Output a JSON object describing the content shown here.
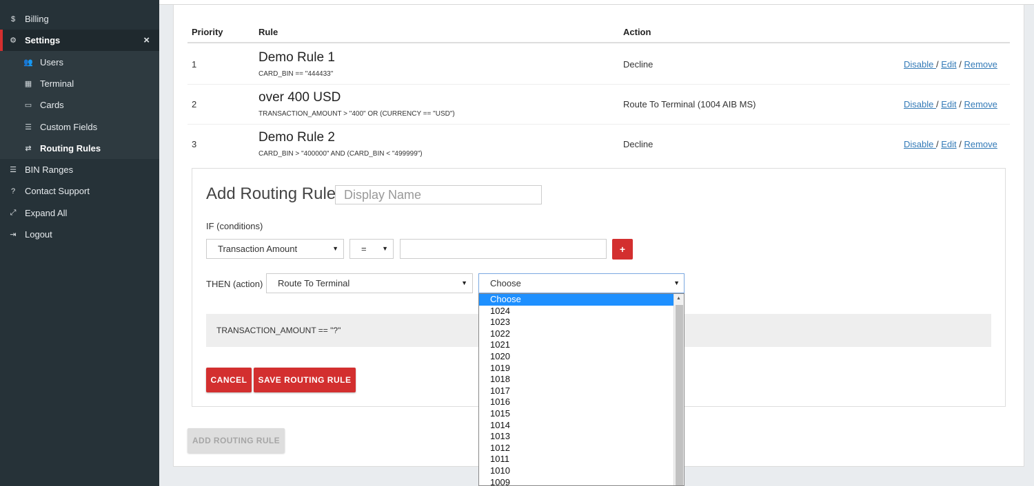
{
  "sidebar": {
    "items": [
      {
        "label": "Billing",
        "icon": "dollar-icon"
      },
      {
        "label": "Settings",
        "icon": "cogs-icon"
      },
      {
        "label": "BIN Ranges",
        "icon": "list-icon"
      },
      {
        "label": "Contact Support",
        "icon": "question-circle-icon"
      },
      {
        "label": "Expand All",
        "icon": "expand-icon"
      },
      {
        "label": "Logout",
        "icon": "sign-out-icon"
      }
    ],
    "settings_sub": [
      {
        "label": "Users",
        "icon": "users-icon"
      },
      {
        "label": "Terminal",
        "icon": "calculator-icon"
      },
      {
        "label": "Cards",
        "icon": "credit-card-icon"
      },
      {
        "label": "Custom Fields",
        "icon": "list-alt-icon"
      },
      {
        "label": "Routing Rules",
        "icon": "exchange-icon"
      }
    ],
    "close_glyph": "×"
  },
  "table": {
    "headers": {
      "priority": "Priority",
      "rule": "Rule",
      "action": "Action"
    },
    "rows": [
      {
        "priority": "1",
        "name": "Demo Rule 1",
        "expr": "CARD_BIN == \"444433\"",
        "action": "Decline"
      },
      {
        "priority": "2",
        "name": "over 400 USD",
        "expr": "TRANSACTION_AMOUNT > \"400\" OR (CURRENCY == \"USD\")",
        "action": "Route To Terminal (1004 AIB MS)"
      },
      {
        "priority": "3",
        "name": "Demo Rule 2",
        "expr": "CARD_BIN > \"400000\" AND (CARD_BIN < \"499999\")",
        "action": "Decline"
      }
    ],
    "link_disable": "Disable ",
    "link_edit": "Edit",
    "link_remove": "Remove",
    "sep": " / "
  },
  "form": {
    "title": "Add Routing Rule",
    "display_name_placeholder": "Display Name",
    "if_label": "IF (conditions)",
    "field_select": "Transaction Amount",
    "operator_select": "=",
    "plus_label": "+",
    "then_label": "THEN (action)",
    "action_select": "Route To Terminal",
    "terminal_select": "Choose",
    "preview": "TRANSACTION_AMOUNT == \"?\"",
    "cancel": "CANCEL",
    "save": "SAVE ROUTING RULE"
  },
  "add_button": "ADD ROUTING RULE",
  "dropdown_options": [
    "Choose",
    "1024",
    "1023",
    "1022",
    "1021",
    "1020",
    "1019",
    "1018",
    "1017",
    "1016",
    "1015",
    "1014",
    "1013",
    "1012",
    "1011",
    "1010",
    "1009"
  ],
  "colors": {
    "sidebar_bg": "#263238",
    "accent_red": "#d32f2f",
    "link_blue": "#337ab7",
    "select_blue": "#1e90ff"
  }
}
